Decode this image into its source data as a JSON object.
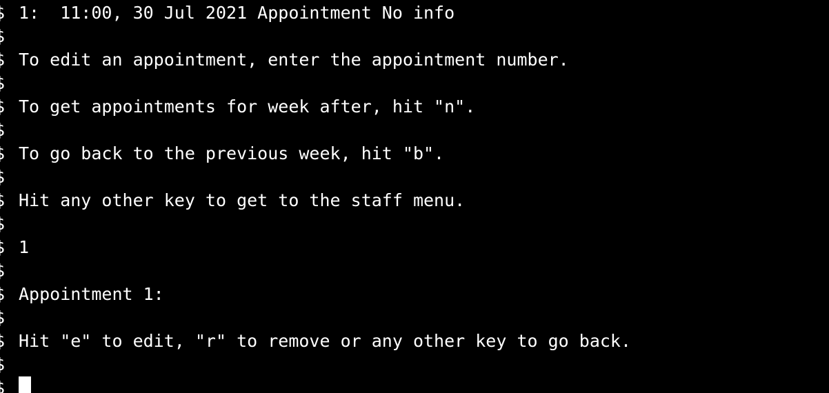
{
  "terminal": {
    "prompt_marker": "$",
    "lines": [
      "1:  11:00, 30 Jul 2021 Appointment No info",
      "",
      "To edit an appointment, enter the appointment number.",
      "",
      "To get appointments for week after, hit \"n\".",
      "",
      "To go back to the previous week, hit \"b\".",
      "",
      "Hit any other key to get to the staff menu.",
      "",
      "1",
      "",
      "Appointment 1:",
      "",
      "Hit \"e\" to edit, \"r\" to remove or any other key to go back.",
      "",
      ""
    ]
  },
  "colors": {
    "background": "#000000",
    "text": "#ffffff",
    "cursor": "#ffffff"
  }
}
